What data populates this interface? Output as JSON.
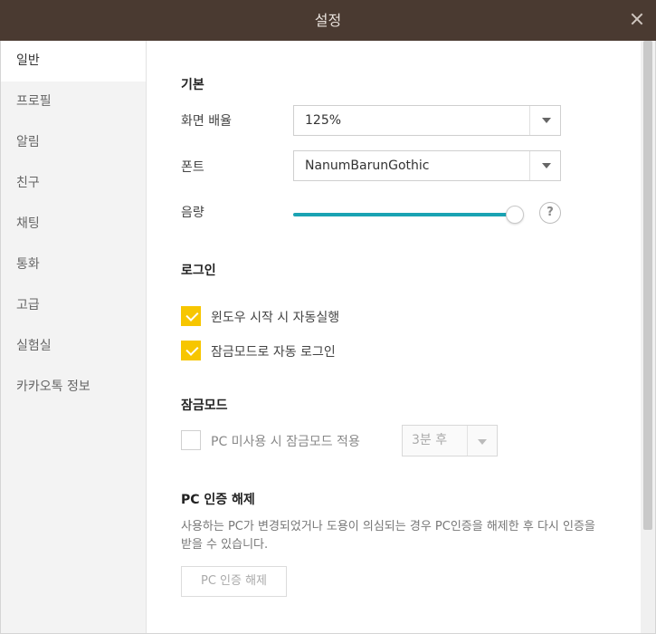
{
  "window": {
    "title": "설정"
  },
  "sidebar": {
    "items": [
      {
        "label": "일반"
      },
      {
        "label": "프로필"
      },
      {
        "label": "알림"
      },
      {
        "label": "친구"
      },
      {
        "label": "채팅"
      },
      {
        "label": "통화"
      },
      {
        "label": "고급"
      },
      {
        "label": "실험실"
      },
      {
        "label": "카카오톡 정보"
      }
    ]
  },
  "general": {
    "section_title": "기본",
    "zoom": {
      "label": "화면 배율",
      "value": "125%"
    },
    "font": {
      "label": "폰트",
      "value": "NanumBarunGothic"
    },
    "volume": {
      "label": "음량",
      "level_percent": 100,
      "help": "?"
    }
  },
  "login": {
    "section_title": "로그인",
    "autostart": {
      "label": "윈도우 시작 시 자동실행",
      "checked": true
    },
    "lock_login": {
      "label": "잠금모드로 자동 로그인",
      "checked": true
    }
  },
  "lockmode": {
    "section_title": "잠금모드",
    "idle_lock": {
      "label": "PC 미사용 시 잠금모드 적용",
      "checked": false
    },
    "delay": {
      "value": "3분 후"
    }
  },
  "pc_auth": {
    "section_title": "PC 인증 해제",
    "description": "사용하는 PC가 변경되었거나 도용이 의심되는 경우 PC인증을 해제한 후 다시 인증을 받을 수 있습니다.",
    "button_label": "PC 인증 해제"
  },
  "colors": {
    "titlebar": "#4a3a31",
    "accent": "#f7c600",
    "slider": "#1aa3b3"
  },
  "icons": {
    "close": "close-icon",
    "dropdown": "chevron-down-icon",
    "help": "question-icon",
    "check": "check-icon"
  }
}
